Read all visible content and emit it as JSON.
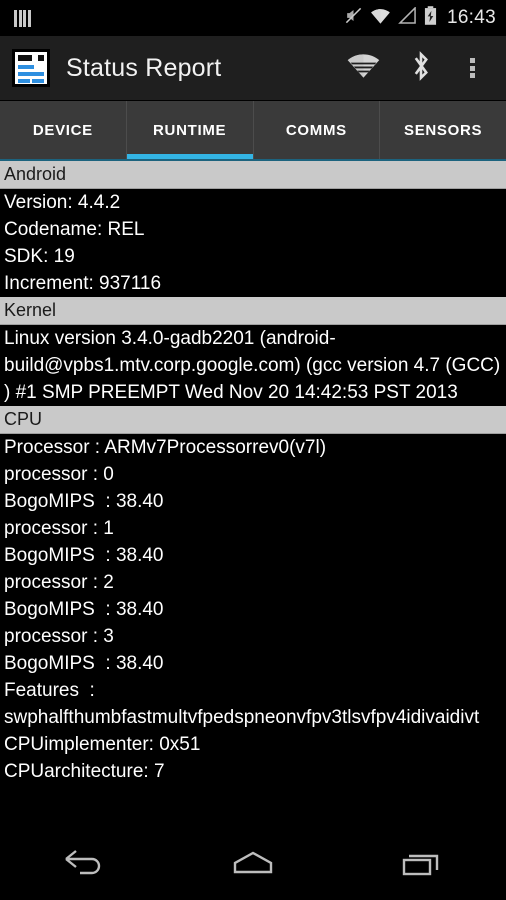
{
  "statusbar": {
    "sim_icon": "sim-bars-icon",
    "mute_icon": "volume-muted-icon",
    "wifi_icon": "wifi-icon",
    "signal_icon": "cell-signal-icon",
    "battery_icon": "battery-charging-icon",
    "clock": "16:43"
  },
  "actionbar": {
    "app_icon": "status-report-app-icon",
    "title": "Status Report",
    "wifi_action_icon": "wifi-icon",
    "bluetooth_action_icon": "bluetooth-icon",
    "overflow_icon": "overflow-menu-icon"
  },
  "tabs": {
    "active_index": 1,
    "items": [
      {
        "label": "DEVICE"
      },
      {
        "label": "RUNTIME"
      },
      {
        "label": "COMMS"
      },
      {
        "label": "SENSORS"
      }
    ],
    "accent_color": "#33b5e5"
  },
  "sections": [
    {
      "header": "Android",
      "rows": [
        "Version: 4.4.2",
        "Codename: REL",
        "SDK: 19",
        "Increment: 937116"
      ]
    },
    {
      "header": "Kernel",
      "rows": [
        "Linux version 3.4.0-gadb2201 (android-build@vpbs1.mtv.corp.google.com) (gcc version 4.7 (GCC) ) #1 SMP PREEMPT Wed Nov 20 14:42:53 PST 2013"
      ]
    },
    {
      "header": "CPU",
      "rows": [
        "Processor : ARMv7Processorrev0(v7l)",
        "processor : 0",
        "BogoMIPS  : 38.40",
        "processor : 1",
        "BogoMIPS  : 38.40",
        "processor : 2",
        "BogoMIPS  : 38.40",
        "processor : 3",
        "BogoMIPS  : 38.40",
        "Features  : swphalfthumbfastmultvfpedspneonvfpv3tlsvfpv4idivaidivt",
        "CPUimplementer: 0x51",
        "CPUarchitecture: 7"
      ]
    }
  ],
  "navbar": {
    "back_icon": "back-icon",
    "home_icon": "home-icon",
    "recents_icon": "recents-icon"
  }
}
